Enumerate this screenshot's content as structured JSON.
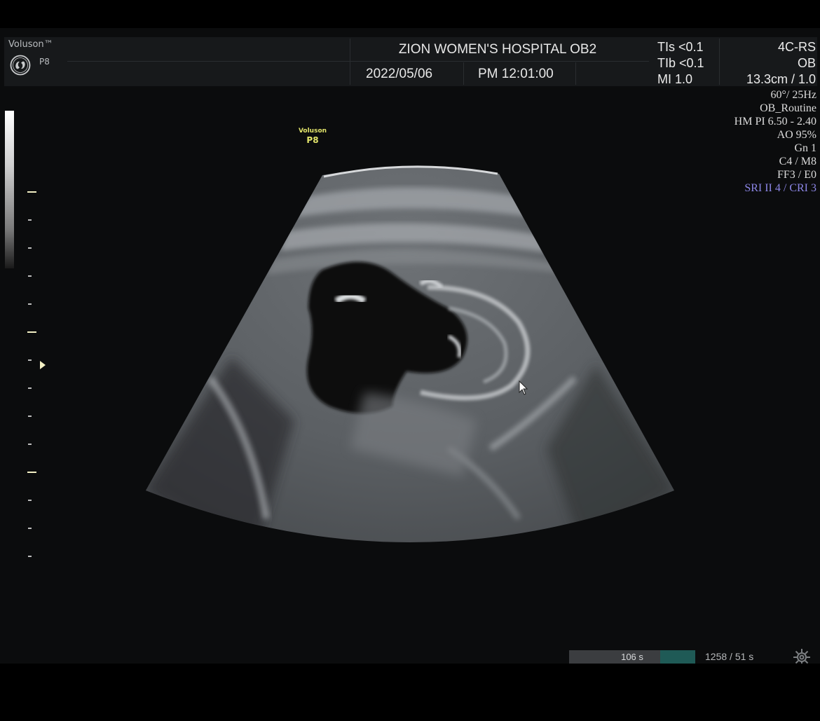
{
  "header": {
    "brand": "Voluson™",
    "probe": "P8",
    "hospital": "ZION WOMEN'S HOSPITAL OB2",
    "date": "2022/05/06",
    "time": "PM 12:01:00"
  },
  "thermal_index": {
    "tis": "TIs <0.1",
    "tib": "TIb <0.1",
    "mi": "MI  1.0"
  },
  "probe_info": {
    "probe_type": "4C-RS",
    "application": "OB",
    "depth": "13.3cm / 1.0"
  },
  "imaging_params": [
    "60°/ 25Hz",
    "OB_Routine",
    "HM PI 6.50 - 2.40",
    "AO 95%",
    "Gn  1",
    "C4 / M8",
    "FF3 / E0",
    "SRI II 4 / CRI 3"
  ],
  "orientation_mark": {
    "brand": "Voluson",
    "probe": "P8"
  },
  "cine": {
    "current": "106  s",
    "progress_fraction": 0.28,
    "frames": "1258 / 51  s"
  },
  "colors": {
    "background": "#0b0c0d",
    "header": "#17191b",
    "orientation_mark": "#e3e56b",
    "sri_text": "#8c86e6",
    "cine_fill": "#1f5a56"
  },
  "icons": {
    "logo": "ge-logo-icon",
    "cursor": "mouse-pointer-icon",
    "settings": "gear-icon",
    "focus": "focus-marker-icon"
  }
}
